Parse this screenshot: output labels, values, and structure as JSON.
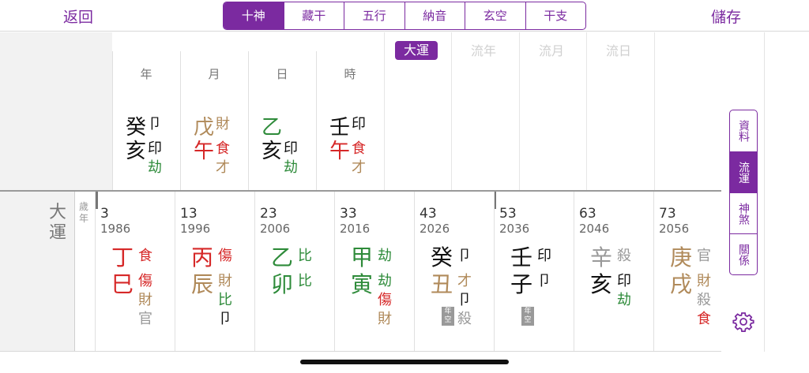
{
  "nav": {
    "back_label": "返回",
    "save_label": "儲存"
  },
  "tabs": [
    {
      "label": "十神",
      "active": true
    },
    {
      "label": "藏干",
      "active": false
    },
    {
      "label": "五行",
      "active": false
    },
    {
      "label": "納音",
      "active": false
    },
    {
      "label": "玄空",
      "active": false
    },
    {
      "label": "干支",
      "active": false
    }
  ],
  "natal": {
    "pillars": [
      {
        "label": "年",
        "stem": "癸",
        "stem_color": "#111111",
        "stem_god": "卩",
        "stem_god_color": "#111111",
        "branch": "亥",
        "branch_color": "#111111",
        "branch_gods": [
          {
            "t": "印",
            "c": "#111111"
          },
          {
            "t": "劫",
            "c": "#2e8b3a"
          }
        ]
      },
      {
        "label": "月",
        "stem": "戊",
        "stem_color": "#b08a5a",
        "stem_god": "財",
        "stem_god_color": "#b08a5a",
        "branch": "午",
        "branch_color": "#d62828",
        "branch_gods": [
          {
            "t": "食",
            "c": "#d62828"
          },
          {
            "t": "才",
            "c": "#b08a5a"
          }
        ]
      },
      {
        "label": "日",
        "stem": "乙",
        "stem_color": "#2e8b3a",
        "stem_god": "",
        "stem_god_color": "#111111",
        "branch": "亥",
        "branch_color": "#111111",
        "branch_gods": [
          {
            "t": "印",
            "c": "#111111"
          },
          {
            "t": "劫",
            "c": "#2e8b3a"
          }
        ]
      },
      {
        "label": "時",
        "stem": "壬",
        "stem_color": "#111111",
        "stem_god": "印",
        "stem_god_color": "#111111",
        "branch": "午",
        "branch_color": "#d62828",
        "branch_gods": [
          {
            "t": "食",
            "c": "#d62828"
          },
          {
            "t": "才",
            "c": "#b08a5a"
          }
        ]
      }
    ],
    "luck_headers": [
      {
        "label": "大運",
        "active": true
      },
      {
        "label": "流年",
        "active": false
      },
      {
        "label": "流月",
        "active": false
      },
      {
        "label": "流日",
        "active": false
      }
    ]
  },
  "decades_section": {
    "title": "大運",
    "side_label": "歲年"
  },
  "decades": [
    {
      "age": "3",
      "year": "1986",
      "stem": "丁",
      "stem_color": "#d62828",
      "stem_god": "食",
      "stem_god_color": "#d62828",
      "branch": "巳",
      "branch_color": "#d62828",
      "branch_gods": [
        {
          "t": "傷",
          "c": "#d62828"
        },
        {
          "t": "財",
          "c": "#b08a5a"
        },
        {
          "t": "官",
          "c": "#999999"
        }
      ],
      "kong": ""
    },
    {
      "age": "13",
      "year": "1996",
      "stem": "丙",
      "stem_color": "#d62828",
      "stem_god": "傷",
      "stem_god_color": "#d62828",
      "branch": "辰",
      "branch_color": "#b08a5a",
      "branch_gods": [
        {
          "t": "財",
          "c": "#b08a5a"
        },
        {
          "t": "比",
          "c": "#2e8b3a"
        },
        {
          "t": "卩",
          "c": "#111111"
        }
      ],
      "kong": ""
    },
    {
      "age": "23",
      "year": "2006",
      "stem": "乙",
      "stem_color": "#2e8b3a",
      "stem_god": "比",
      "stem_god_color": "#2e8b3a",
      "branch": "卯",
      "branch_color": "#2e8b3a",
      "branch_gods": [
        {
          "t": "比",
          "c": "#2e8b3a"
        }
      ],
      "kong": ""
    },
    {
      "age": "33",
      "year": "2016",
      "stem": "甲",
      "stem_color": "#2e8b3a",
      "stem_god": "劫",
      "stem_god_color": "#2e8b3a",
      "branch": "寅",
      "branch_color": "#2e8b3a",
      "branch_gods": [
        {
          "t": "劫",
          "c": "#2e8b3a"
        },
        {
          "t": "傷",
          "c": "#d62828"
        },
        {
          "t": "財",
          "c": "#b08a5a"
        }
      ],
      "kong": ""
    },
    {
      "age": "43",
      "year": "2026",
      "stem": "癸",
      "stem_color": "#111111",
      "stem_god": "卩",
      "stem_god_color": "#111111",
      "branch": "丑",
      "branch_color": "#b08a5a",
      "branch_gods": [
        {
          "t": "才",
          "c": "#b08a5a"
        },
        {
          "t": "卩",
          "c": "#111111"
        },
        {
          "t": "殺",
          "c": "#999999"
        }
      ],
      "kong": "年空"
    },
    {
      "age": "53",
      "year": "2036",
      "stem": "壬",
      "stem_color": "#111111",
      "stem_god": "印",
      "stem_god_color": "#111111",
      "branch": "子",
      "branch_color": "#111111",
      "branch_gods": [
        {
          "t": "卩",
          "c": "#111111"
        }
      ],
      "kong": "年空"
    },
    {
      "age": "63",
      "year": "2046",
      "stem": "辛",
      "stem_color": "#999999",
      "stem_god": "殺",
      "stem_god_color": "#999999",
      "branch": "亥",
      "branch_color": "#111111",
      "branch_gods": [
        {
          "t": "印",
          "c": "#111111"
        },
        {
          "t": "劫",
          "c": "#2e8b3a"
        }
      ],
      "kong": ""
    },
    {
      "age": "73",
      "year": "2056",
      "stem": "庚",
      "stem_color": "#b08a5a",
      "stem_god": "官",
      "stem_god_color": "#999999",
      "branch": "戌",
      "branch_color": "#b08a5a",
      "branch_gods": [
        {
          "t": "財",
          "c": "#b08a5a"
        },
        {
          "t": "殺",
          "c": "#999999"
        },
        {
          "t": "食",
          "c": "#d62828"
        }
      ],
      "kong": ""
    }
  ],
  "side_tabs": [
    {
      "label": "資料",
      "active": false
    },
    {
      "label": "流運",
      "active": true
    },
    {
      "label": "神煞",
      "active": false
    },
    {
      "label": "關係",
      "active": false
    }
  ],
  "colors": {
    "accent": "#7b2aa0",
    "fire": "#d62828",
    "wood": "#2e8b3a",
    "earth": "#b08a5a",
    "water": "#111111",
    "metal": "#999999"
  },
  "icons": {
    "settings": "gear-icon"
  }
}
